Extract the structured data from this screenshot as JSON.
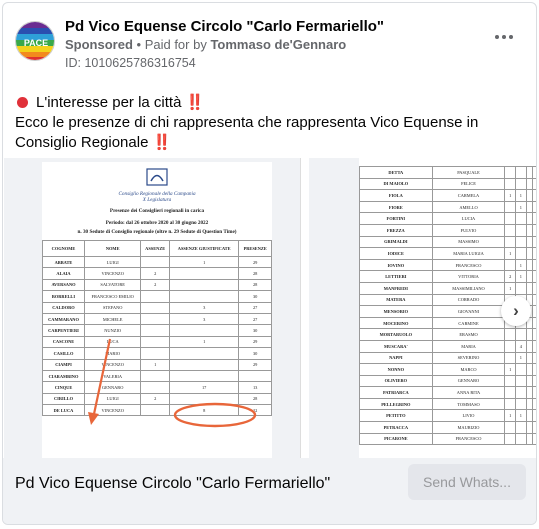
{
  "ad": {
    "page_name": "Pd Vico Equense Circolo \"Carlo Fermariello\"",
    "sponsored": "Sponsored",
    "separator": " • ",
    "paid_for_prefix": "Paid for by ",
    "paid_for_name": "Tommaso de'Gennaro",
    "id_label": "ID: 1010625786316754",
    "line1": "L'interesse per la città ‼️",
    "line2": "Ecco le presenze di chi rappresenta che rappresenta Vico Equense in Consiglio Regionale ‼️"
  },
  "slide1": {
    "org_line1": "Consiglio Regionale della Campania",
    "org_line2": "X Legislatura",
    "heading": "Presenze dei Consiglieri regionali in carica",
    "period": "Periodo: dal 26 ottobre 2020 al 30 giugno 2022",
    "sessions": "n. 30 Sedute di Consiglio regionale (oltre n. 29 Sedute di Question Time)",
    "columns": [
      "COGNOME",
      "NOME",
      "ASSENZE",
      "ASSENZE GIUSTIFICATE",
      "PRESENZE"
    ],
    "rows": [
      [
        "ABBATE",
        "LUIGI",
        "",
        "1",
        "29"
      ],
      [
        "ALAIA",
        "VINCENZO",
        "2",
        "",
        "28"
      ],
      [
        "AVERSANO",
        "SALVATORE",
        "2",
        "",
        "28"
      ],
      [
        "BORRELLI",
        "FRANCESCO EMILIO",
        "",
        "",
        "30"
      ],
      [
        "CALDORO",
        "STEFANO",
        "",
        "3",
        "27"
      ],
      [
        "CAMMARANO",
        "MICHELE",
        "",
        "3",
        "27"
      ],
      [
        "CARPENTIERI",
        "NUNZIO",
        "",
        "",
        "30"
      ],
      [
        "CASCONE",
        "LUCA",
        "",
        "1",
        "29"
      ],
      [
        "CASILLO",
        "MARIO",
        "",
        "",
        "30"
      ],
      [
        "CIAMPI",
        "VINCENZO",
        "1",
        "",
        "29"
      ],
      [
        "CIARAMBINO",
        "VALERIA",
        "",
        "",
        ""
      ],
      [
        "CINQUE",
        "GENNARO",
        "",
        "17",
        "13"
      ],
      [
        "CIRILLO",
        "LUIGI",
        "2",
        "",
        "28"
      ],
      [
        "DE LUCA",
        "VINCENZO",
        "",
        "8",
        "22"
      ]
    ]
  },
  "slide2": {
    "rows": [
      [
        "DETTA",
        "PASQUALE",
        "",
        ""
      ],
      [
        "DI MAIOLO",
        "FELICE",
        "",
        ""
      ],
      [
        "FIOLA",
        "CARMELA",
        "1",
        "1"
      ],
      [
        "FIORE",
        "AMELLO",
        "",
        "1"
      ],
      [
        "FORTINI",
        "LUCIA",
        "",
        ""
      ],
      [
        "FREZZA",
        "FULVIO",
        "",
        ""
      ],
      [
        "GRIMALDI",
        "MASSIMO",
        "",
        ""
      ],
      [
        "IODICE",
        "MARIA LUIGIA",
        "1",
        ""
      ],
      [
        "IOVINO",
        "FRANCESCO",
        "",
        "1"
      ],
      [
        "LETTIERI",
        "VITTORIA",
        "2",
        "1"
      ],
      [
        "MANFREDI",
        "MASSIMILIANO",
        "1",
        ""
      ],
      [
        "MATERA",
        "CORRADO",
        "",
        ""
      ],
      [
        "MENSORIO",
        "GIOVANNI",
        "",
        ""
      ],
      [
        "MOCERINO",
        "CARMINE",
        "",
        ""
      ],
      [
        "MORTARUOLO",
        "ERASMO",
        "",
        ""
      ],
      [
        "MUSCARA'",
        "MARIA",
        "",
        "4"
      ],
      [
        "NAPPI",
        "SEVERINO",
        "",
        "1"
      ],
      [
        "NONNO",
        "MARCO",
        "1",
        ""
      ],
      [
        "OLIVIERO",
        "GENNARO",
        "",
        ""
      ],
      [
        "PATRIARCA",
        "ANNA RITA",
        "",
        ""
      ],
      [
        "PELLEGRINO",
        "TOMMASO",
        "",
        ""
      ],
      [
        "PETITTO",
        "LIVIO",
        "1",
        "1"
      ],
      [
        "PETRACCA",
        "MAURIZIO",
        "",
        ""
      ],
      [
        "PICARONE",
        "FRANCESCO",
        "",
        ""
      ]
    ]
  },
  "footer": {
    "title": "Pd Vico Equense Circolo \"Carlo Fermariello\"",
    "cta": "Send Whats..."
  },
  "icons": {
    "more": "more-options-icon",
    "next": "chevron-right-icon",
    "bullet": "red-circle-icon"
  },
  "colors": {
    "annotation": "#e8663a",
    "cta_bg": "#e4e6eb",
    "muted_text": "#65676b"
  }
}
